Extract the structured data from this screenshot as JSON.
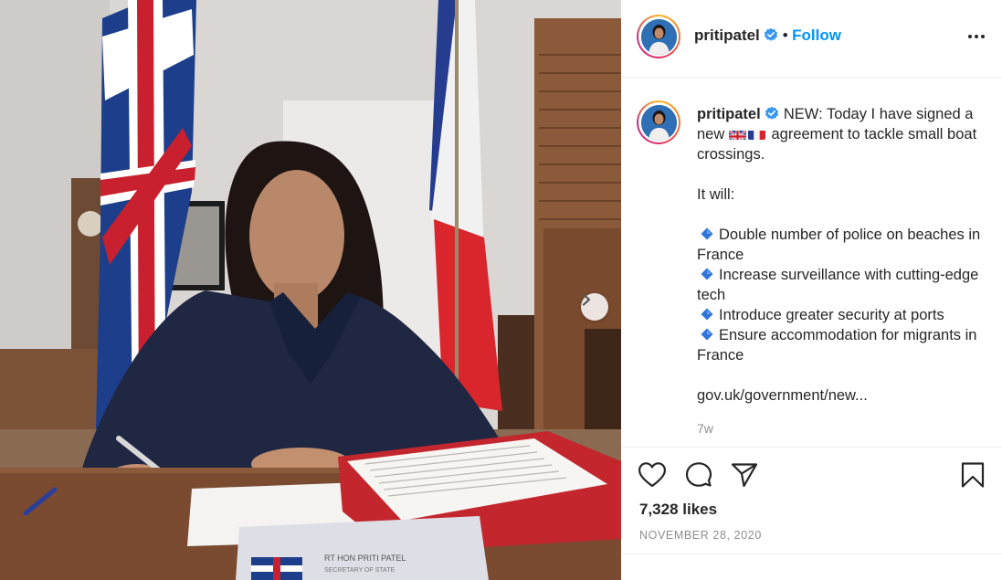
{
  "post": {
    "username": "pritipatel",
    "follow_label": "Follow",
    "separator": "•",
    "caption": {
      "intro": "NEW: Today I have signed a new",
      "intro_after_flags": "agreement to tackle small boat crossings.",
      "it_will": "It will:",
      "bullets": [
        "Double number of police on beaches in France",
        "Increase surveillance with cutting-edge tech",
        "Introduce greater security at ports",
        "Ensure accommodation for migrants in France"
      ],
      "link": "gov.uk/government/new..."
    },
    "time_ago": "7w",
    "likes": "7,328 likes",
    "date": "NOVEMBER 28, 2020",
    "nameplate": {
      "line1": "RT HON PRITI PATEL",
      "line2": "SECRETARY OF STATE"
    }
  },
  "icons": {
    "verified": "verified-badge-icon",
    "more": "more-options-icon",
    "next": "next-arrow-icon",
    "like": "heart-icon",
    "comment": "comment-icon",
    "share": "share-icon",
    "save": "bookmark-icon"
  },
  "colors": {
    "link_blue": "#0095f6",
    "text": "#262626",
    "muted": "#8e8e8e",
    "verified_blue": "#3897f0"
  }
}
